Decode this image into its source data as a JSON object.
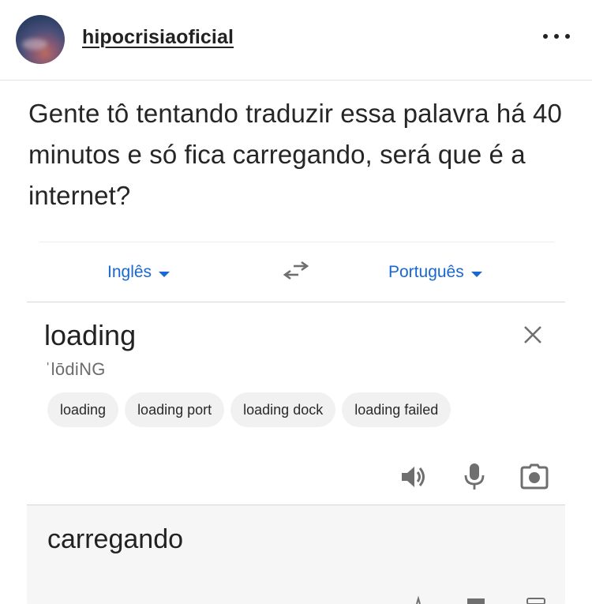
{
  "post": {
    "username": "hipocrisiaoficial",
    "caption": "Gente tô tentando traduzir essa palavra há 40 minutos e só fica carregando, será que é a internet?"
  },
  "translator": {
    "source_language": "Inglês",
    "target_language": "Português",
    "input_text": "loading",
    "phonetic": "ˈlōdiNG",
    "suggestions": [
      "loading",
      "loading port",
      "loading dock",
      "loading failed"
    ],
    "output_text": "carregando",
    "icons": [
      "swap-languages-icon",
      "close-icon",
      "speaker-icon",
      "microphone-icon",
      "camera-icon"
    ]
  },
  "colors": {
    "link_blue": "#1967d2",
    "icon_gray": "#6f6f6f",
    "chip_bg": "#f1f1f1",
    "result_bg": "#f6f6f6"
  }
}
